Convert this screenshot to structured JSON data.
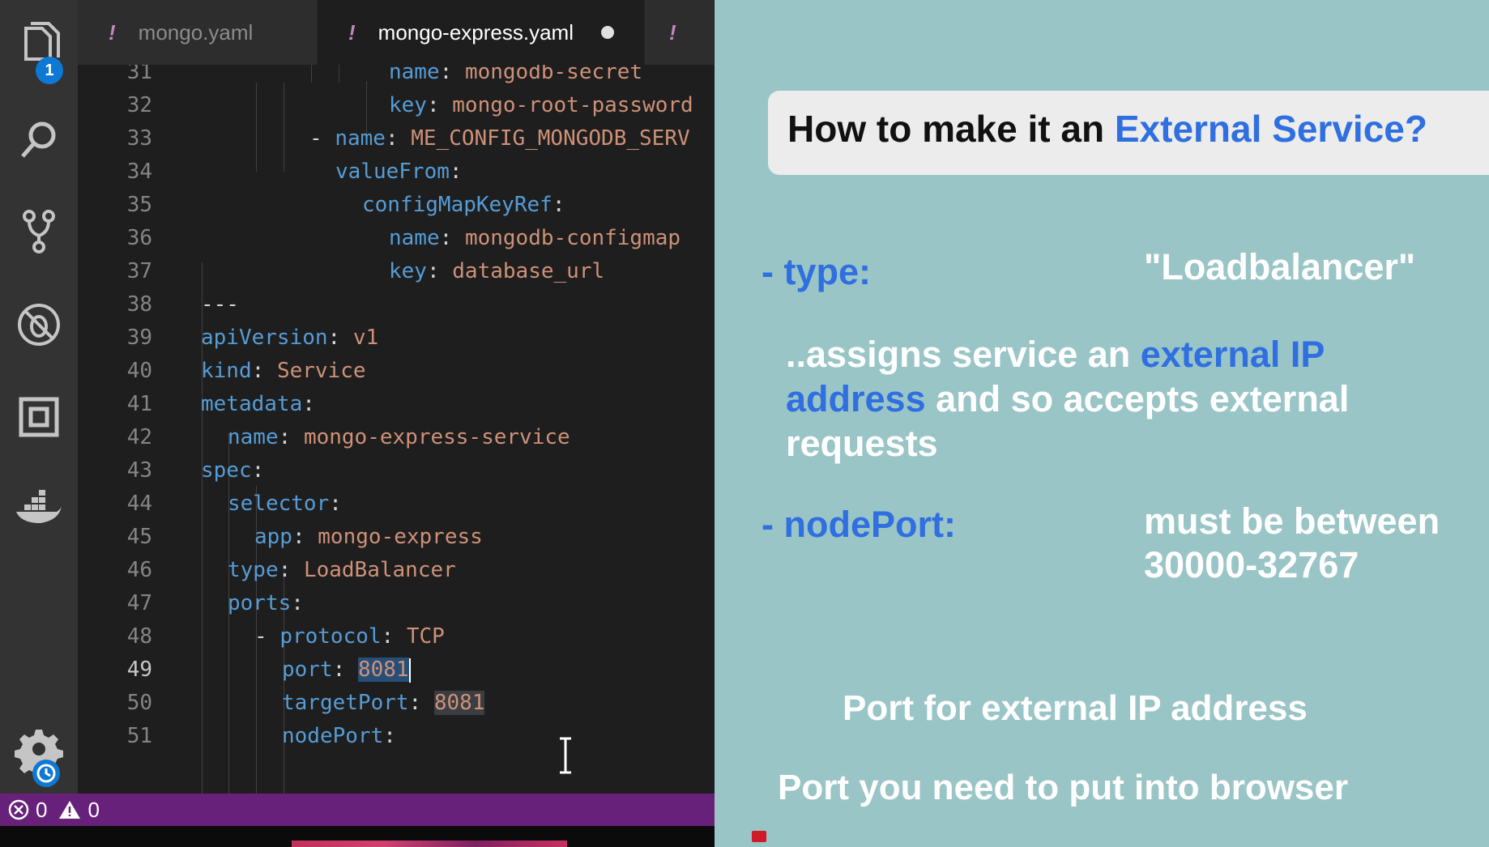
{
  "activity_bar": {
    "explorer_badge": "1"
  },
  "tabs": [
    {
      "label": "mongo.yaml",
      "marker": "!"
    },
    {
      "label": "mongo-express.yaml",
      "marker": "!"
    },
    {
      "label": "",
      "marker": "!"
    }
  ],
  "editor": {
    "lines": [
      {
        "n": "31",
        "key": "name",
        "val": "mongodb-secret"
      },
      {
        "n": "32",
        "key": "key",
        "val": "mongo-root-password"
      },
      {
        "n": "33",
        "dash": "- ",
        "key": "name",
        "val": "ME_CONFIG_MONGODB_SERV"
      },
      {
        "n": "34",
        "key": "valueFrom",
        "val": ""
      },
      {
        "n": "35",
        "key": "configMapKeyRef",
        "val": ""
      },
      {
        "n": "36",
        "key": "name",
        "val": "mongodb-configmap"
      },
      {
        "n": "37",
        "key": "key",
        "val": "database_url"
      },
      {
        "n": "38",
        "raw": "---"
      },
      {
        "n": "39",
        "key": "apiVersion",
        "val": "v1"
      },
      {
        "n": "40",
        "key": "kind",
        "val": "Service"
      },
      {
        "n": "41",
        "key": "metadata",
        "val": ""
      },
      {
        "n": "42",
        "key": "name",
        "val": "mongo-express-service"
      },
      {
        "n": "43",
        "key": "spec",
        "val": ""
      },
      {
        "n": "44",
        "key": "selector",
        "val": ""
      },
      {
        "n": "45",
        "key": "app",
        "val": "mongo-express"
      },
      {
        "n": "46",
        "key": "type",
        "val": "LoadBalancer"
      },
      {
        "n": "47",
        "key": "ports",
        "val": ""
      },
      {
        "n": "48",
        "dash": "- ",
        "key": "protocol",
        "val": "TCP"
      },
      {
        "n": "49",
        "key": "port",
        "val": "8081"
      },
      {
        "n": "50",
        "key": "targetPort",
        "val": "8081"
      },
      {
        "n": "51",
        "key": "nodePort",
        "val": ""
      }
    ]
  },
  "status_bar": {
    "errors": "0",
    "warnings": "0"
  },
  "slide": {
    "title_prefix": "How to make it an ",
    "title_highlight": "External Service?",
    "type_label": "- type:",
    "type_value": "\"Loadbalancer\"",
    "assigns_1a": "..assigns service an ",
    "assigns_1b": "external IP",
    "assigns_2a": "address",
    "assigns_2b": " and so accepts external",
    "assigns_3": "requests",
    "nodeport_label": "- nodePort:",
    "nodeport_value_1": "must be between",
    "nodeport_value_2": "30000-32767",
    "port_note": "Port for external IP address",
    "browser_note": "Port you need to put into browser"
  },
  "colors": {
    "yaml_key": "#569cd6",
    "yaml_value": "#ce9178",
    "status_bar": "#68217a",
    "slide_bg": "#9ac5c7",
    "slide_accent": "#2f6fe0"
  }
}
